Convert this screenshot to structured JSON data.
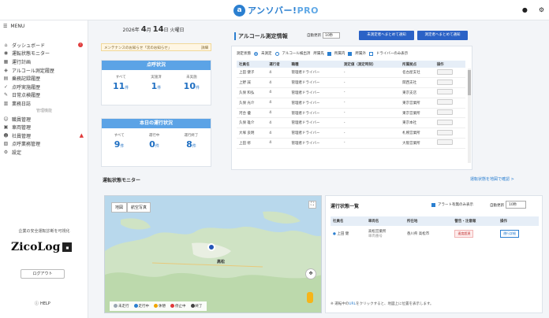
{
  "header": {
    "logo_text": "アンソバー!",
    "logo_pro": "PRO",
    "icons": [
      "bell-icon",
      "gear-icon"
    ]
  },
  "sidebar": {
    "menu_label": "MENU",
    "items": [
      {
        "label": "ダッシュボード",
        "icon": "home",
        "badge": "!"
      },
      {
        "label": "運転状態モニター",
        "icon": "monitor"
      },
      {
        "label": "運行計画",
        "icon": "calendar"
      },
      {
        "label": "アルコール測定履歴",
        "icon": "alcohol"
      },
      {
        "label": "乗務記録履歴",
        "icon": "document"
      },
      {
        "label": "点呼実施履歴",
        "icon": "check"
      },
      {
        "label": "日常点検履歴",
        "icon": "wrench"
      },
      {
        "label": "業務日誌",
        "icon": "book"
      }
    ],
    "section_label": "管理機能",
    "items2": [
      {
        "label": "職員管理",
        "icon": "user"
      },
      {
        "label": "車両管理",
        "icon": "truck"
      },
      {
        "label": "社員管理",
        "icon": "users",
        "warn": "▲"
      },
      {
        "label": "点呼業務管理",
        "icon": "clipboard"
      },
      {
        "label": "設定",
        "icon": "gear"
      }
    ],
    "brand_note": "企業の安全運転診断を可視化",
    "brand_name": "ZicoLog",
    "logout_label": "ログアウト",
    "help_label": "HELP"
  },
  "summary": {
    "year": "2026年",
    "month": "4",
    "month_unit": "月",
    "day": "14",
    "day_unit": "日",
    "weekday": "火曜日",
    "notice_text": "メンテナンスのお知らせ「次のお知らせ」",
    "notice_link": "詳細",
    "rollcall": {
      "title": "点呼状況",
      "stats": [
        {
          "label": "すべて",
          "value": "11",
          "unit": "件"
        },
        {
          "label": "実施済",
          "value": "1",
          "unit": "件"
        },
        {
          "label": "未実施",
          "value": "10",
          "unit": "件"
        }
      ]
    },
    "operations": {
      "title": "本日の運行状況",
      "stats": [
        {
          "label": "すべて",
          "value": "9",
          "unit": "件"
        },
        {
          "label": "運行中",
          "value": "0",
          "unit": "件"
        },
        {
          "label": "運行終了",
          "value": "8",
          "unit": "件"
        }
      ]
    }
  },
  "alcohol": {
    "title": "アルコール測定情報",
    "filter_label": "自動更新",
    "filter_value": "10秒",
    "btn_all": "未測定者へまとめて通知",
    "btn_selected": "測定者へまとめて通知",
    "filters": {
      "label": "測定状態",
      "opt1": "未測定",
      "opt2": "アルコール検出済",
      "label2": "所属先",
      "chk1": "所属内",
      "chk2": "所属外",
      "chk3": "ドライバーのみ表示"
    },
    "columns": [
      "社員名",
      "運行者",
      "職種",
      "測定値（測定時刻）",
      "所属拠点",
      "操作"
    ],
    "rows": [
      {
        "name": "上田 健子",
        "num": "4",
        "role": "管理者ドライバー",
        "value": "-",
        "site": "名古屋支社"
      },
      {
        "name": "上野 誠",
        "num": "4",
        "role": "管理者ドライバー",
        "value": "-",
        "site": "関西支社"
      },
      {
        "name": "久保 和弘",
        "num": "4",
        "role": "管理者ドライバー",
        "value": "-",
        "site": "東京支店"
      },
      {
        "name": "久保 光介",
        "num": "4",
        "role": "管理者ドライバー",
        "value": "-",
        "site": "東京営業所"
      },
      {
        "name": "河合 優",
        "num": "4",
        "role": "管理者ドライバー",
        "value": "-",
        "site": "東京営業所"
      },
      {
        "name": "久保 雄介",
        "num": "4",
        "role": "管理者ドライバー",
        "value": "-",
        "site": "東京本社"
      },
      {
        "name": "大塚 良明",
        "num": "4",
        "role": "管理者ドライバー",
        "value": "-",
        "site": "札幌営業所"
      },
      {
        "name": "上田 修",
        "num": "4",
        "role": "管理者ドライバー",
        "value": "-",
        "site": "大阪営業所"
      }
    ]
  },
  "monitor": {
    "title": "運転状態モニター",
    "link": "運転状態を地図で確認 >",
    "map_tabs": [
      "地図",
      "航空写真"
    ],
    "car_label": "高松",
    "legend": [
      "未走行",
      "走行中",
      "休憩",
      "停止中",
      "終了"
    ],
    "legend_colors": [
      "#9aa6b2",
      "#2b7fd0",
      "#f0a400",
      "#e03a3a",
      "#444444"
    ]
  },
  "operation_list": {
    "title": "運行状態一覧",
    "alert_check": "アラート有無のみ表示",
    "select_label": "自動更新",
    "select_value": "10秒",
    "columns": [
      "社員名",
      "車両名",
      "所在地",
      "警告・注意報",
      "操作"
    ],
    "rows": [
      {
        "name": "上田 健",
        "vehicle": "高松営業所",
        "vehicle_sub": "車両番号",
        "location": "香川県 高松市",
        "alert": "速度超過",
        "action": "運行詳細"
      }
    ],
    "footer_prefix": "※ 運転中の",
    "footer_link": "URL",
    "footer_suffix": "をクリックすると、地図上に位置を表示します。"
  }
}
